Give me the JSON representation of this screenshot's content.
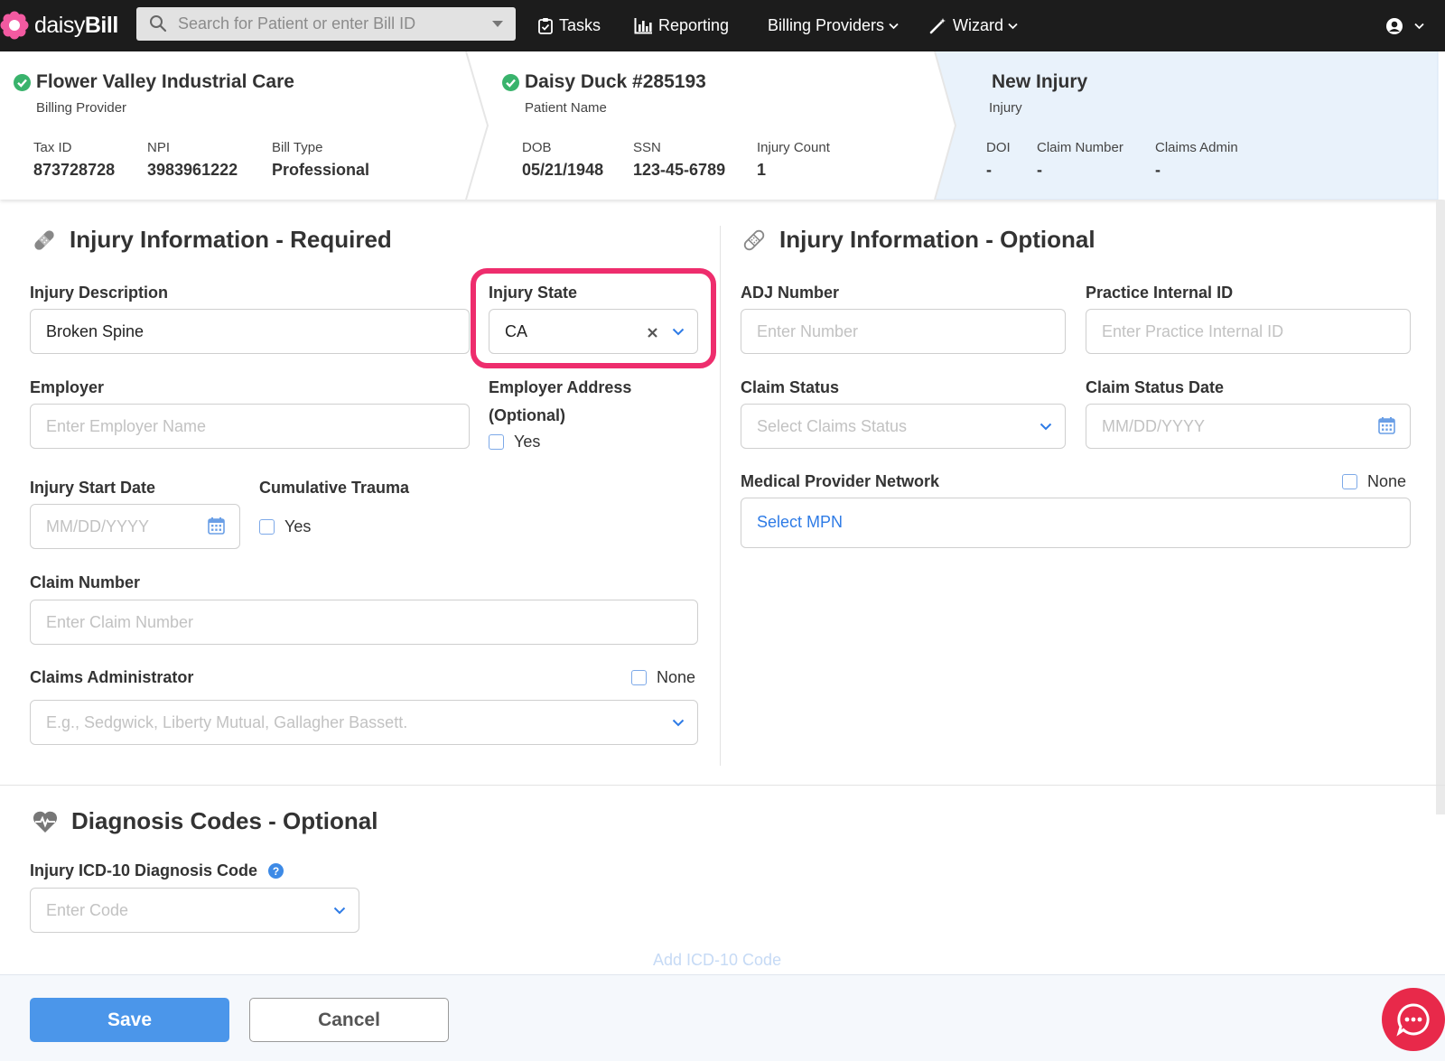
{
  "nav": {
    "brand_light": "daisy",
    "brand_bold": "Bill",
    "search_placeholder": "Search for Patient or enter Bill ID",
    "tasks": "Tasks",
    "reporting": "Reporting",
    "billing_providers": "Billing Providers",
    "wizard": "Wizard"
  },
  "provider": {
    "name": "Flower Valley Industrial Care",
    "subtitle": "Billing Provider",
    "tax_id_label": "Tax ID",
    "tax_id": "873728728",
    "npi_label": "NPI",
    "npi": "3983961222",
    "bill_type_label": "Bill Type",
    "bill_type": "Professional"
  },
  "patient": {
    "name": "Daisy Duck #285193",
    "subtitle": "Patient Name",
    "dob_label": "DOB",
    "dob": "05/21/1948",
    "ssn_label": "SSN",
    "ssn": "123-45-6789",
    "injury_count_label": "Injury Count",
    "injury_count": "1"
  },
  "injury_header": {
    "title": "New Injury",
    "subtitle": "Injury",
    "doi_label": "DOI",
    "doi": "-",
    "claim_number_label": "Claim Number",
    "claim_number": "-",
    "claims_admin_label": "Claims Admin",
    "claims_admin": "-"
  },
  "required": {
    "title": "Injury Information - Required",
    "injury_description_label": "Injury Description",
    "injury_description_value": "Broken Spine",
    "injury_state_label": "Injury State",
    "injury_state_value": "CA",
    "employer_label": "Employer",
    "employer_placeholder": "Enter Employer Name",
    "employer_address_label_1": "Employer Address",
    "employer_address_label_2": "(Optional)",
    "employer_address_yes": "Yes",
    "injury_start_date_label": "Injury Start Date",
    "injury_start_date_placeholder": "MM/DD/YYYY",
    "cumulative_trauma_label": "Cumulative Trauma",
    "cumulative_trauma_yes": "Yes",
    "claim_number_label": "Claim Number",
    "claim_number_placeholder": "Enter Claim Number",
    "claims_admin_label": "Claims Administrator",
    "claims_admin_none": "None",
    "claims_admin_placeholder": "E.g., Sedgwick, Liberty Mutual, Gallagher Bassett."
  },
  "optional": {
    "title": "Injury Information - Optional",
    "adj_number_label": "ADJ Number",
    "adj_number_placeholder": "Enter Number",
    "practice_internal_id_label": "Practice Internal ID",
    "practice_internal_id_placeholder": "Enter Practice Internal ID",
    "claim_status_label": "Claim Status",
    "claim_status_placeholder": "Select Claims Status",
    "claim_status_date_label": "Claim Status Date",
    "claim_status_date_placeholder": "MM/DD/YYYY",
    "mpn_label": "Medical Provider Network",
    "mpn_none": "None",
    "mpn_select": "Select MPN"
  },
  "diagnosis": {
    "title": "Diagnosis Codes - Optional",
    "icd_label": "Injury ICD-10 Diagnosis Code",
    "icd_placeholder": "Enter Code",
    "add_code": "Add ICD-10 Code"
  },
  "footer": {
    "save": "Save",
    "cancel": "Cancel"
  },
  "colors": {
    "accent": "#4b96ea",
    "highlight": "#ee2d6d",
    "success": "#39b36c",
    "nav_bg": "#1c1c1c"
  }
}
